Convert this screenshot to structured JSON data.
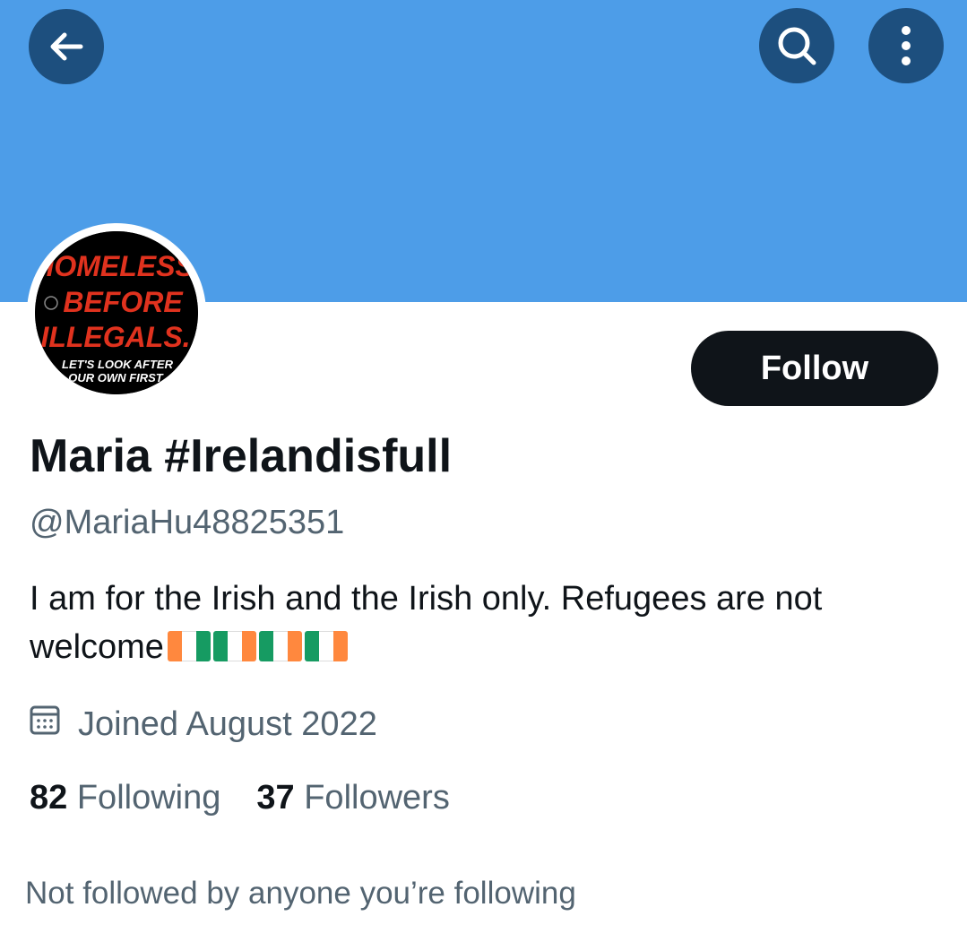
{
  "header": {
    "banner_color": "#4d9de8",
    "back_icon": "arrow-left-icon",
    "search_icon": "search-icon",
    "more_icon": "more-vertical-icon"
  },
  "avatar": {
    "line1": "HOMELESS",
    "line2": "BEFORE",
    "line3": "ILLEGALS.",
    "line4": "LET'S LOOK AFTER",
    "line5": "OUR OWN FIRST"
  },
  "profile": {
    "follow_label": "Follow",
    "display_name": "Maria #Irelandisfull",
    "handle": "@MariaHu48825351",
    "bio_text": "I am for the Irish and the Irish only. Refugees are not welcome",
    "bio_flags": [
      "ireland-flag",
      "ireland-flag",
      "ireland-flag",
      "ireland-flag"
    ],
    "joined": "Joined August 2022",
    "following_count": "82",
    "following_label": "Following",
    "followers_count": "37",
    "followers_label": "Followers",
    "not_followed": "Not followed by anyone you’re following"
  }
}
